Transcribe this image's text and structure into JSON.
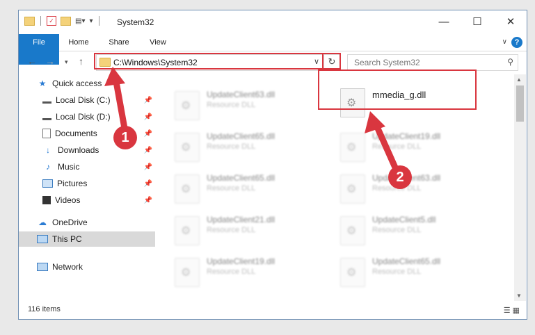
{
  "window": {
    "title": "System32"
  },
  "ribbon": {
    "tabs": [
      "File",
      "Home",
      "Share",
      "View"
    ],
    "help_label": "?"
  },
  "navigation": {
    "address_path": "C:\\Windows\\System32",
    "search_placeholder": "Search System32"
  },
  "sidebar": {
    "items": [
      {
        "label": "Quick access",
        "icon": "star-icon",
        "pinned": false
      },
      {
        "label": "Local Disk (C:)",
        "icon": "drive-icon",
        "pinned": true
      },
      {
        "label": "Local Disk (D:)",
        "icon": "drive-icon",
        "pinned": true
      },
      {
        "label": "Documents",
        "icon": "documents-icon",
        "pinned": true
      },
      {
        "label": "Downloads",
        "icon": "download-icon",
        "pinned": true
      },
      {
        "label": "Music",
        "icon": "music-icon",
        "pinned": true
      },
      {
        "label": "Pictures",
        "icon": "pictures-icon",
        "pinned": true
      },
      {
        "label": "Videos",
        "icon": "videos-icon",
        "pinned": true
      },
      {
        "label": "OneDrive",
        "icon": "onedrive-icon",
        "pinned": false
      },
      {
        "label": "This PC",
        "icon": "computer-icon",
        "pinned": false,
        "selected": true
      },
      {
        "label": "Network",
        "icon": "network-icon",
        "pinned": false
      }
    ]
  },
  "files": {
    "highlighted": {
      "name": "mmedia_g.dll"
    },
    "column1": [
      {
        "name": "UpdateClient63.dll",
        "type": "Resource DLL"
      },
      {
        "name": "UpdateClient65.dll",
        "type": "Resource DLL"
      },
      {
        "name": "UpdateClient65.dll",
        "type": "Resource DLL"
      },
      {
        "name": "UpdateClient21.dll",
        "type": "Resource DLL"
      },
      {
        "name": "UpdateClient19.dll",
        "type": "Resource DLL"
      }
    ],
    "column2": [
      {
        "name": "UpdateClient19.dll",
        "type": "Resource DLL"
      },
      {
        "name": "UpdateClient63.dll",
        "type": "Resource DLL"
      },
      {
        "name": "UpdateClient5.dll",
        "type": "Resource DLL"
      },
      {
        "name": "UpdateClient65.dll",
        "type": "Resource DLL"
      }
    ]
  },
  "status": {
    "item_count": "116 items"
  },
  "annotations": {
    "step1": "1",
    "step2": "2",
    "color": "#d9363f"
  },
  "colors": {
    "accent": "#1979ca",
    "highlight": "#d9363f"
  }
}
